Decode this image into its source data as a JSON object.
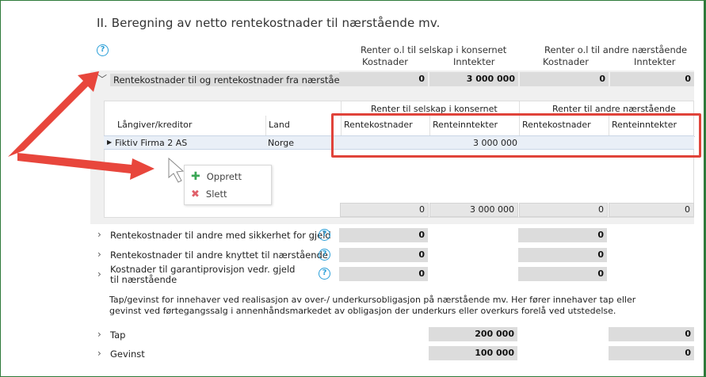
{
  "title": "II. Beregning av netto rentekostnader til nærstående mv.",
  "columns": {
    "group1": "Renter o.l til selskap i konsernet",
    "group2": "Renter o.l til andre nærstående",
    "costs": "Kostnader",
    "income": "Inntekter"
  },
  "expanded_section": {
    "label": "Rentekostnader til og rentekostnader fra nærstående",
    "values": [
      "0",
      "3 000 000",
      "0",
      "0"
    ]
  },
  "grid": {
    "group1": "Renter til selskap i konsernet",
    "group2": "Renter til andre nærstående",
    "headers": [
      "Långiver/kreditor",
      "Land",
      "Rentekostnader",
      "Renteinntekter",
      "Rentekostnader",
      "Renteinntekter"
    ],
    "row": {
      "name": "Fiktiv Firma 2 AS",
      "country": "Norge",
      "values": [
        "",
        "3 000 000",
        "",
        ""
      ]
    },
    "totals": [
      "0",
      "3 000 000",
      "0",
      "0"
    ]
  },
  "context_menu": {
    "create": "Opprett",
    "delete": "Slett"
  },
  "sections": [
    {
      "label": "Rentekostnader til andre med sikkerhet for gjeld",
      "v1": "0",
      "v2": "0"
    },
    {
      "label": "Rentekostnader til andre knyttet til nærstående",
      "v1": "0",
      "v2": "0"
    },
    {
      "label": "Kostnader til garantiprovisjon vedr. gjeld til nærstående",
      "v1": "0",
      "v2": "0"
    }
  ],
  "paragraph": "Tap/gevinst for innehaver ved realisasjon av over-/ underkursobligasjon på nærstående mv. Her fører innehaver tap eller gevinst ved førtegangssalg i annenhåndsmarkedet av obligasjon der underkurs eller overkurs forelå ved utstedelse.",
  "gains": [
    {
      "label": "Tap",
      "v1": "200 000",
      "v2": "0"
    },
    {
      "label": "Gevinst",
      "v1": "100 000",
      "v2": "0"
    }
  ],
  "colors": {
    "accent": "#2a9fd8",
    "annotation": "#e0433a",
    "field": "#dcdcdc"
  }
}
